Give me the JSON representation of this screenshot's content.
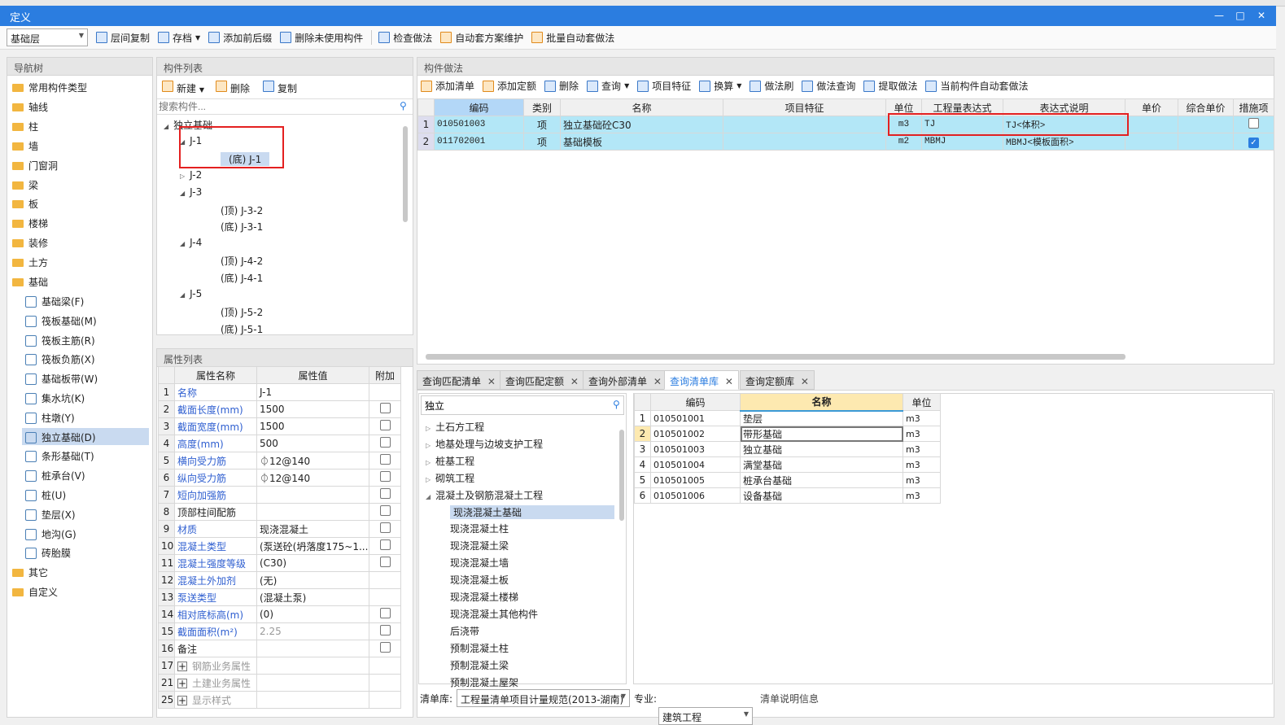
{
  "window": {
    "title": "定义",
    "minimize": "—",
    "maximize": "□",
    "close": "✕"
  },
  "toolbar": {
    "floor": "基础层",
    "items": [
      "层间复制",
      "存档",
      "添加前后缀",
      "删除未使用构件",
      "检查做法",
      "自动套方案维护",
      "批量自动套做法"
    ]
  },
  "nav": {
    "title": "导航树",
    "folders": [
      "常用构件类型",
      "轴线",
      "柱",
      "墙",
      "门窗洞",
      "梁",
      "板",
      "楼梯",
      "装修",
      "土方",
      "基础"
    ],
    "sub": [
      "基础梁(F)",
      "筏板基础(M)",
      "筏板主筋(R)",
      "筏板负筋(X)",
      "基础板带(W)",
      "集水坑(K)",
      "柱墩(Y)",
      "独立基础(D)",
      "条形基础(T)",
      "桩承台(V)",
      "桩(U)",
      "垫层(X)",
      "地沟(G)",
      "砖胎膜"
    ],
    "selected": "独立基础(D)",
    "after": [
      "其它",
      "自定义"
    ]
  },
  "components": {
    "title": "构件列表",
    "new": "新建",
    "delete": "删除",
    "copy": "复制",
    "search_placeholder": "搜索构件...",
    "tree": [
      {
        "l": 0,
        "t": "独立基础",
        "e": "◢"
      },
      {
        "l": 1,
        "t": "J-1",
        "e": "◢"
      },
      {
        "l": 2,
        "t": "(底) J-1",
        "sel": true
      },
      {
        "l": 1,
        "t": "J-2",
        "e": "▷"
      },
      {
        "l": 1,
        "t": "J-3",
        "e": "◢"
      },
      {
        "l": 2,
        "t": "(顶) J-3-2"
      },
      {
        "l": 2,
        "t": "(底) J-3-1"
      },
      {
        "l": 1,
        "t": "J-4",
        "e": "◢"
      },
      {
        "l": 2,
        "t": "(顶) J-4-2"
      },
      {
        "l": 2,
        "t": "(底) J-4-1"
      },
      {
        "l": 1,
        "t": "J-5",
        "e": "◢"
      },
      {
        "l": 2,
        "t": "(顶) J-5-2"
      },
      {
        "l": 2,
        "t": "(底) J-5-1"
      }
    ]
  },
  "properties": {
    "title": "属性列表",
    "headers": [
      "属性名称",
      "属性值",
      "附加"
    ],
    "rows": [
      {
        "n": "1",
        "name": "名称",
        "value": "J-1",
        "c": "blue",
        "chk": null
      },
      {
        "n": "2",
        "name": "截面长度(mm)",
        "value": "1500",
        "c": "blue",
        "chk": false
      },
      {
        "n": "3",
        "name": "截面宽度(mm)",
        "value": "1500",
        "c": "blue",
        "chk": false
      },
      {
        "n": "4",
        "name": "高度(mm)",
        "value": "500",
        "c": "blue",
        "chk": false
      },
      {
        "n": "5",
        "name": "横向受力筋",
        "value": "⏀12@140",
        "c": "blue",
        "chk": false
      },
      {
        "n": "6",
        "name": "纵向受力筋",
        "value": "⏀12@140",
        "c": "blue",
        "chk": false
      },
      {
        "n": "7",
        "name": "短向加强筋",
        "value": "",
        "c": "blue",
        "chk": false
      },
      {
        "n": "8",
        "name": "顶部柱间配筋",
        "value": "",
        "c": "",
        "chk": false
      },
      {
        "n": "9",
        "name": "材质",
        "value": "现浇混凝土",
        "c": "blue",
        "chk": false
      },
      {
        "n": "10",
        "name": "混凝土类型",
        "value": "(泵送砼(坍落度175~1...",
        "c": "blue",
        "chk": false
      },
      {
        "n": "11",
        "name": "混凝土强度等级",
        "value": "(C30)",
        "c": "blue",
        "chk": false
      },
      {
        "n": "12",
        "name": "混凝土外加剂",
        "value": "(无)",
        "c": "blue",
        "chk": null
      },
      {
        "n": "13",
        "name": "泵送类型",
        "value": "(混凝土泵)",
        "c": "blue",
        "chk": null
      },
      {
        "n": "14",
        "name": "相对底标高(m)",
        "value": "(0)",
        "c": "blue",
        "chk": false
      },
      {
        "n": "15",
        "name": "截面面积(m²)",
        "value": "2.25",
        "c": "blue",
        "chk": false,
        "vgray": true
      },
      {
        "n": "16",
        "name": "备注",
        "value": "",
        "c": "",
        "chk": false
      },
      {
        "n": "17",
        "name": "钢筋业务属性",
        "value": "",
        "c": "gray",
        "chk": null,
        "plus": true
      },
      {
        "n": "21",
        "name": "土建业务属性",
        "value": "",
        "c": "gray",
        "chk": null,
        "plus": true
      },
      {
        "n": "25",
        "name": "显示样式",
        "value": "",
        "c": "gray",
        "chk": null,
        "plus": true
      }
    ]
  },
  "method": {
    "title": "构件做法",
    "toolbar": [
      "添加清单",
      "添加定额",
      "删除",
      "查询",
      "项目特征",
      "换算",
      "做法刷",
      "做法查询",
      "提取做法",
      "当前构件自动套做法"
    ],
    "headers": [
      "编码",
      "类别",
      "名称",
      "项目特征",
      "单位",
      "工程量表达式",
      "表达式说明",
      "单价",
      "综合单价",
      "措施项"
    ],
    "rows": [
      {
        "n": "1",
        "code": "010501003",
        "type": "项",
        "name": "独立基础砼C30",
        "feat": "",
        "unit": "m3",
        "expr": "TJ",
        "desc": "TJ<体积>",
        "checked": false
      },
      {
        "n": "2",
        "code": "011702001",
        "type": "项",
        "name": "基础模板",
        "feat": "",
        "unit": "m2",
        "expr": "MBMJ",
        "desc": "MBMJ<模板面积>",
        "checked": true
      }
    ]
  },
  "query": {
    "tabs": [
      "查询匹配清单",
      "查询匹配定额",
      "查询外部清单",
      "查询清单库",
      "查询定额库"
    ],
    "active_tab": "查询清单库",
    "search_value": "独立",
    "tree": [
      {
        "t": "土石方工程",
        "e": "▷",
        "l": 0
      },
      {
        "t": "地基处理与边坡支护工程",
        "e": "▷",
        "l": 0
      },
      {
        "t": "桩基工程",
        "e": "▷",
        "l": 0
      },
      {
        "t": "砌筑工程",
        "e": "▷",
        "l": 0
      },
      {
        "t": "混凝土及钢筋混凝土工程",
        "e": "◢",
        "l": 0
      },
      {
        "t": "现浇混凝土基础",
        "l": 1,
        "sel": true
      },
      {
        "t": "现浇混凝土柱",
        "l": 1
      },
      {
        "t": "现浇混凝土梁",
        "l": 1
      },
      {
        "t": "现浇混凝土墙",
        "l": 1
      },
      {
        "t": "现浇混凝土板",
        "l": 1
      },
      {
        "t": "现浇混凝土楼梯",
        "l": 1
      },
      {
        "t": "现浇混凝土其他构件",
        "l": 1
      },
      {
        "t": "后浇带",
        "l": 1
      },
      {
        "t": "预制混凝土柱",
        "l": 1
      },
      {
        "t": "预制混凝土梁",
        "l": 1
      },
      {
        "t": "预制混凝土屋架",
        "l": 1
      }
    ],
    "headers": [
      "编码",
      "名称",
      "单位"
    ],
    "rows": [
      {
        "n": "1",
        "code": "010501001",
        "name": "垫层",
        "unit": "m3"
      },
      {
        "n": "2",
        "code": "010501002",
        "name": "带形基础",
        "unit": "m3"
      },
      {
        "n": "3",
        "code": "010501003",
        "name": "独立基础",
        "unit": "m3"
      },
      {
        "n": "4",
        "code": "010501004",
        "name": "满堂基础",
        "unit": "m3"
      },
      {
        "n": "5",
        "code": "010501005",
        "name": "桩承台基础",
        "unit": "m3"
      },
      {
        "n": "6",
        "code": "010501006",
        "name": "设备基础",
        "unit": "m3"
      }
    ],
    "library_label": "清单库:",
    "library_value": "工程量清单项目计量规范(2013-湖南)",
    "major_label": "专业:",
    "major_value": "建筑工程",
    "info": "清单说明信息"
  },
  "colors": {
    "title_bar": "#2b7de0",
    "row_highlight": "#b3e7f7",
    "annotation": "#e42020"
  }
}
